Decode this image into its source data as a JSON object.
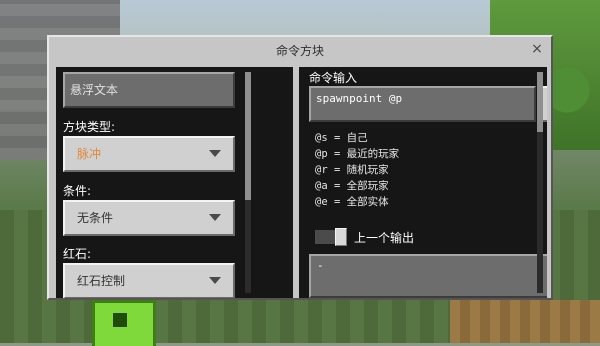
{
  "dialog": {
    "title": "命令方块",
    "close_glyph": "×"
  },
  "left": {
    "hover_text": "悬浮文本",
    "block_type": {
      "label": "方块类型:",
      "value": "脉冲",
      "value_color": "#e0883a"
    },
    "condition": {
      "label": "条件:",
      "value": "无条件"
    },
    "redstone": {
      "label": "红石:",
      "value": "红石控制"
    }
  },
  "right": {
    "command_label": "命令输入",
    "command_value": "spawnpoint @p",
    "plus_label": "+",
    "selectors": [
      "@s = 自己",
      "@p = 最近的玩家",
      "@r = 随机玩家",
      "@a = 全部玩家",
      "@e = 全部实体"
    ],
    "previous_output_label": "上一个输出",
    "previous_output_toggle": true,
    "output_value": "-"
  }
}
